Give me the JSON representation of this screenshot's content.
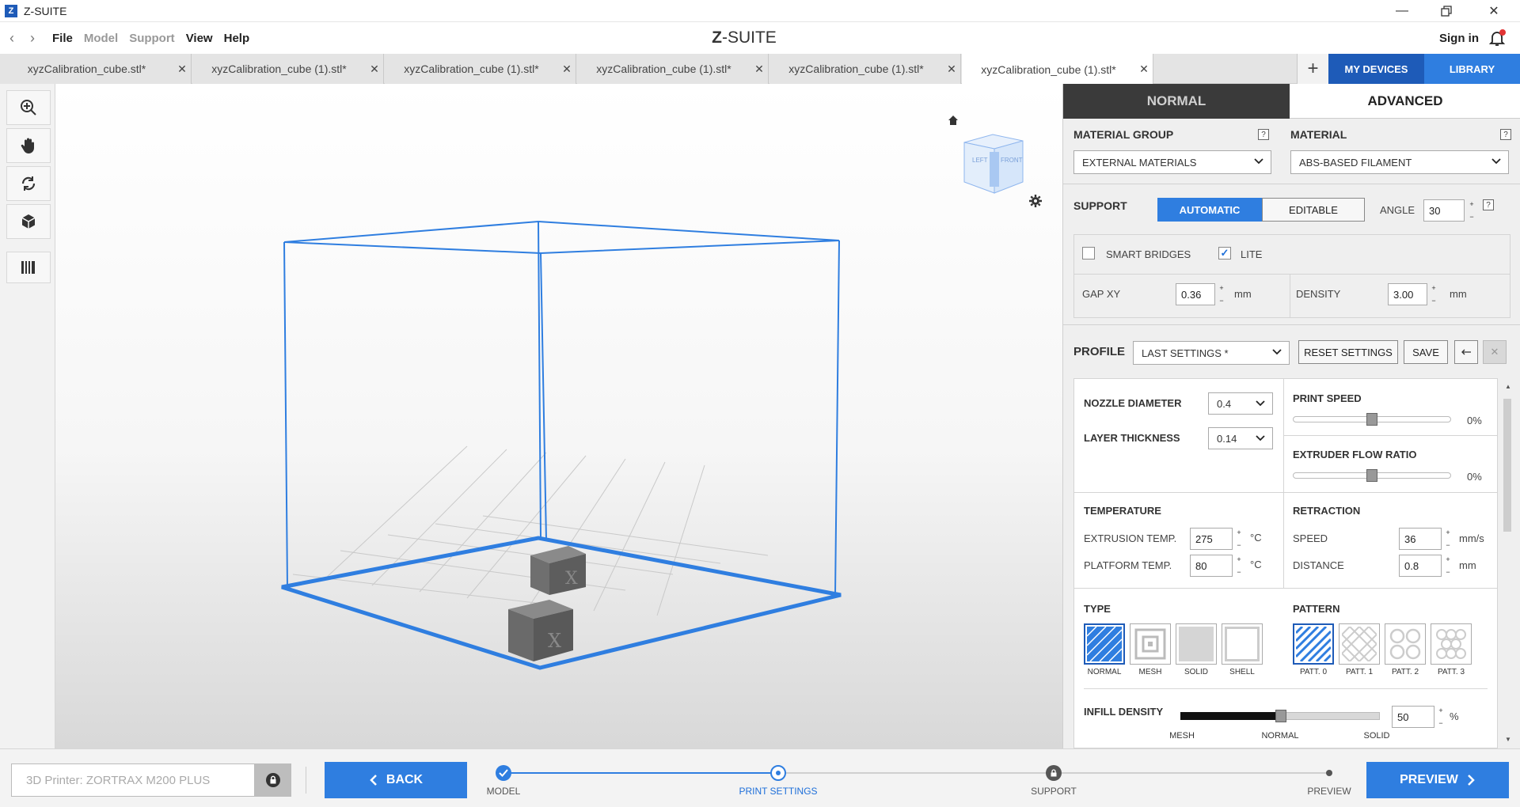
{
  "window": {
    "title": "Z-SUITE"
  },
  "menu": {
    "items": [
      {
        "label": "File",
        "enabled": true
      },
      {
        "label": "Model",
        "enabled": false
      },
      {
        "label": "Support",
        "enabled": false
      },
      {
        "label": "View",
        "enabled": true
      },
      {
        "label": "Help",
        "enabled": true
      }
    ],
    "brand_z": "Z",
    "brand_rest": "-SUITE",
    "signin": "Sign in"
  },
  "tabs": [
    {
      "label": "xyzCalibration_cube.stl*",
      "active": false
    },
    {
      "label": "xyzCalibration_cube (1).stl*",
      "active": false
    },
    {
      "label": "xyzCalibration_cube (1).stl*",
      "active": false
    },
    {
      "label": "xyzCalibration_cube (1).stl*",
      "active": false
    },
    {
      "label": "xyzCalibration_cube (1).stl*",
      "active": false
    },
    {
      "label": "xyzCalibration_cube (1).stl*",
      "active": true
    }
  ],
  "topbuttons": {
    "devices": "MY DEVICES",
    "library": "LIBRARY"
  },
  "viewcube": {
    "left": "LEFT",
    "front": "FRONT"
  },
  "panel": {
    "mode_normal": "NORMAL",
    "mode_advanced": "ADVANCED",
    "material_group_label": "MATERIAL GROUP",
    "material_group_value": "EXTERNAL MATERIALS",
    "material_label": "MATERIAL",
    "material_value": "ABS-BASED FILAMENT",
    "help_glyph": "?",
    "support_label": "SUPPORT",
    "support_auto": "AUTOMATIC",
    "support_editable": "EDITABLE",
    "angle_label": "ANGLE",
    "angle_value": "30",
    "smart_bridges": "SMART BRIDGES",
    "smart_bridges_checked": false,
    "lite": "LITE",
    "lite_checked": true,
    "gap_xy_label": "GAP XY",
    "gap_xy_value": "0.36",
    "density_label": "DENSITY",
    "density_value": "3.00",
    "unit_mm": "mm",
    "profile_label": "PROFILE",
    "profile_value": "LAST SETTINGS *",
    "reset_settings": "RESET SETTINGS",
    "save": "SAVE",
    "nozzle_label": "NOZZLE DIAMETER",
    "nozzle_value": "0.4",
    "layer_label": "LAYER THICKNESS",
    "layer_value": "0.14",
    "print_speed_label": "PRINT SPEED",
    "print_speed_value": "0%",
    "flow_label": "EXTRUDER FLOW RATIO",
    "flow_value": "0%",
    "temperature_label": "TEMPERATURE",
    "extrusion_label": "EXTRUSION TEMP.",
    "extrusion_value": "275",
    "platform_label": "PLATFORM TEMP.",
    "platform_value": "80",
    "unit_c": "°C",
    "retraction_label": "RETRACTION",
    "speed_label": "SPEED",
    "speed_value": "36",
    "unit_mms": "mm/s",
    "distance_label": "DISTANCE",
    "distance_value": "0.8",
    "type_label": "TYPE",
    "types": [
      "NORMAL",
      "MESH",
      "SOLID",
      "SHELL"
    ],
    "pattern_label": "PATTERN",
    "patterns": [
      "PATT. 0",
      "PATT. 1",
      "PATT. 2",
      "PATT. 3"
    ],
    "infill_label": "INFILL DENSITY",
    "infill_value": "50",
    "infill_unit": "%",
    "infill_marks": [
      "MESH",
      "NORMAL",
      "SOLID"
    ]
  },
  "bottom": {
    "printer_placeholder": "3D Printer: ZORTRAX M200 PLUS",
    "back": "BACK",
    "steps": [
      "MODEL",
      "PRINT SETTINGS",
      "SUPPORT",
      "PREVIEW"
    ],
    "preview": "PREVIEW"
  },
  "colors": {
    "accent": "#2f7ee0",
    "dark": "#333333"
  }
}
